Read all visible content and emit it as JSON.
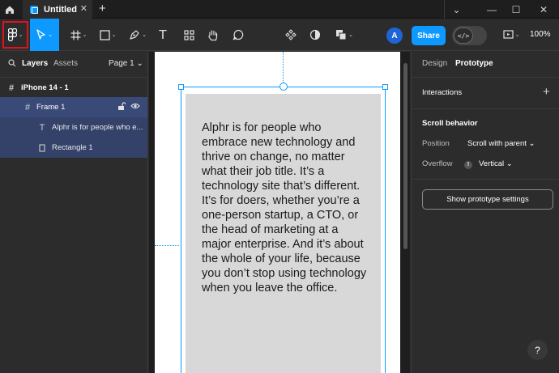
{
  "titlebar": {
    "tab_title": "Untitled",
    "close_glyph": "✕",
    "plus_glyph": "+",
    "chevron_glyph": "⌄",
    "minimize_glyph": "—",
    "maximize_glyph": "☐",
    "window_close_glyph": "✕"
  },
  "toolbar": {
    "avatar_initial": "A",
    "share_label": "Share",
    "dev_mode_glyph": "</>",
    "zoom_label": "100%",
    "chevron": "⌄",
    "text_tool_glyph": "T"
  },
  "left_panel": {
    "tabs": {
      "layers": "Layers",
      "assets": "Assets"
    },
    "page_selector": "Page 1 ⌄",
    "layers": [
      {
        "name": "iPhone 14 - 1",
        "icon": "frame-icon"
      },
      {
        "name": "Frame 1",
        "icon": "frame-icon"
      },
      {
        "name": "Alphr is for people who e...",
        "icon": "text-icon"
      },
      {
        "name": "Rectangle 1",
        "icon": "rectangle-icon"
      }
    ]
  },
  "canvas": {
    "body_text": "Alphr is for people who embrace new technology and thrive on change, no matter what their job title. It’s a technology site that’s different. It’s for doers, whether you’re a one-person startup, a CTO, or the head of marketing at a major enterprise. And it’s about the whole of your life, because you don’t stop using technology when you leave the office."
  },
  "right_panel": {
    "tabs": {
      "design": "Design",
      "prototype": "Prototype"
    },
    "interactions_label": "Interactions",
    "plus_glyph": "+",
    "scroll_behavior_label": "Scroll behavior",
    "position_label": "Position",
    "position_value": "Scroll with parent ⌄",
    "overflow_label": "Overflow",
    "overflow_info": "!",
    "overflow_value": "Vertical ⌄",
    "show_settings_button": "Show prototype settings",
    "help_glyph": "?"
  },
  "colors": {
    "accent": "#0d99ff",
    "selection_row": "#3a4a78",
    "highlight_box": "#e0121e"
  }
}
